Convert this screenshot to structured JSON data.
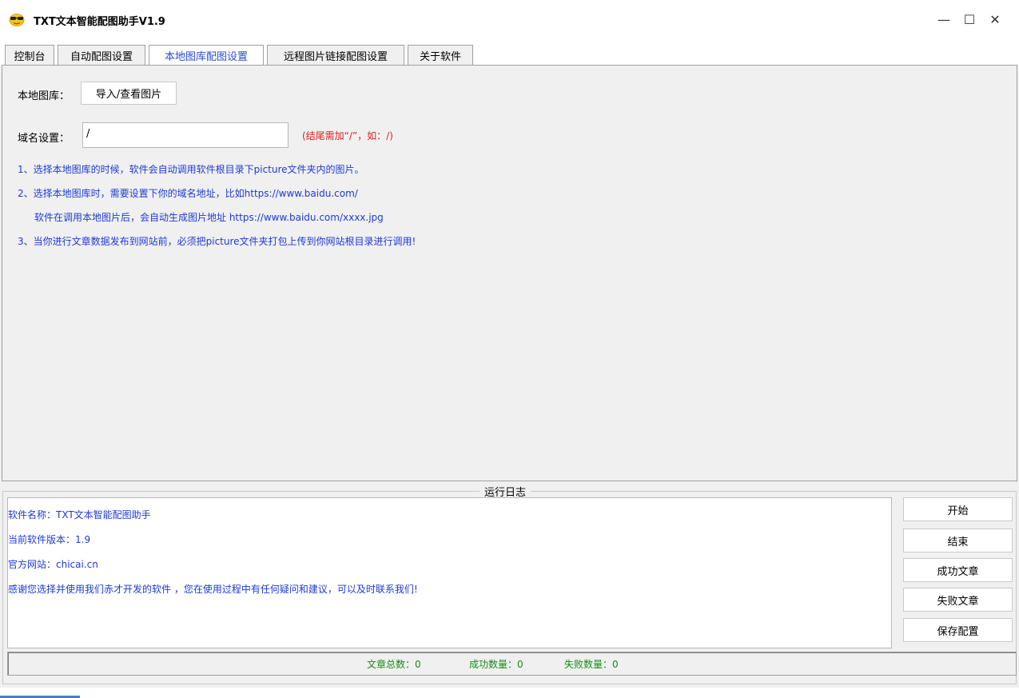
{
  "window": {
    "title": "TXT文本智能配图助手V1.9",
    "minimize_glyph": "—",
    "maximize_glyph": "☐",
    "close_glyph": "✕"
  },
  "tabs": [
    {
      "label": "控制台",
      "active": false
    },
    {
      "label": "自动配图设置",
      "active": false
    },
    {
      "label": "本地图库配图设置",
      "active": true
    },
    {
      "label": "远程图片链接配图设置",
      "active": false
    },
    {
      "label": "关于软件",
      "active": false
    }
  ],
  "local_gallery": {
    "gallery_label": "本地图库：",
    "import_button": "导入/查看图片",
    "domain_label": "域名设置：",
    "domain_value": "/",
    "domain_hint": "(结尾需加“/”，如：/)",
    "info_lines": [
      "1、选择本地图库的时候，软件会自动调用软件根目录下picture文件夹内的图片。",
      "2、选择本地图库时，需要设置下你的域名地址，比如https://www.baidu.com/",
      "软件在调用本地图片后，会自动生成图片地址 https://www.baidu.com/xxxx.jpg",
      "3、当你进行文章数据发布到网站前，必须把picture文件夹打包上传到你网站根目录进行调用!"
    ]
  },
  "log": {
    "caption": "运行日志",
    "lines": [
      "软件名称：TXT文本智能配图助手",
      "当前软件版本：1.9",
      "官方网站：chicai.cn",
      "感谢您选择并使用我们赤才开发的软件 ，您在使用过程中有任何疑问和建议，可以及时联系我们!"
    ]
  },
  "side_buttons": {
    "start": "开始",
    "stop": "结束",
    "success": "成功文章",
    "failed": "失败文章",
    "save": "保存配置"
  },
  "status": {
    "total": "文章总数：0",
    "success": "成功数量：0",
    "failed": "失败数量：0"
  },
  "colors": {
    "info_blue": "#1f3ad6",
    "hint_red": "#e02020",
    "status_green": "#1a8a1a"
  }
}
